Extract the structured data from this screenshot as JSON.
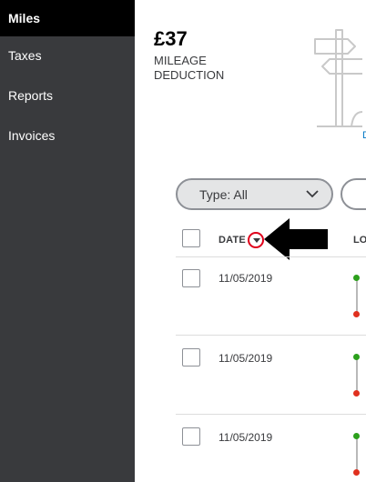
{
  "sidebar": {
    "items": [
      {
        "label": "Miles",
        "active": true
      },
      {
        "label": "Taxes",
        "active": false
      },
      {
        "label": "Reports",
        "active": false
      },
      {
        "label": "Invoices",
        "active": false
      }
    ]
  },
  "summary": {
    "amount": "£37",
    "label": "MILEAGE DEDUCTION",
    "illustration_link": "D"
  },
  "filters": {
    "type_label": "Type: All"
  },
  "table": {
    "headers": {
      "date": "DATE",
      "location": "LO"
    },
    "rows": [
      {
        "date": "11/05/2019"
      },
      {
        "date": "11/05/2019"
      },
      {
        "date": "11/05/2019"
      }
    ]
  },
  "colors": {
    "sidebar_bg": "#393a3d",
    "active_bg": "#000000",
    "start_dot": "#2ca01c",
    "end_dot": "#e0301e",
    "highlight": "#e0001b"
  }
}
